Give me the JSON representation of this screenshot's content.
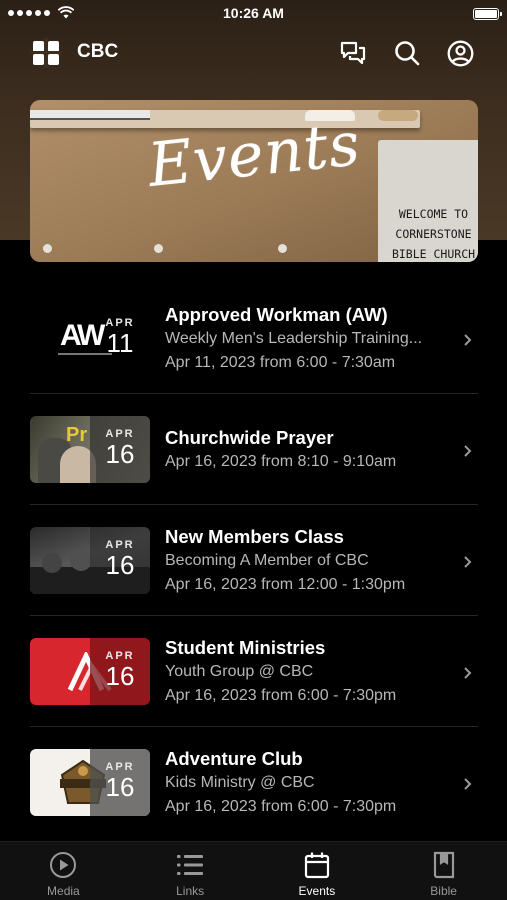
{
  "status_bar": {
    "time": "10:26 AM"
  },
  "header": {
    "app_title": "CBC",
    "icons": [
      "chat-icon",
      "search-icon",
      "profile-icon"
    ]
  },
  "hero": {
    "title": "Events",
    "sign_lines": [
      "WELCOME TO",
      "CORNERSTONE",
      "BIBLE CHURCH"
    ]
  },
  "events": [
    {
      "title": "Approved Workman (AW)",
      "subtitle": "Weekly Men's Leadership Training...",
      "schedule": "Apr 11, 2023 from 6:00 - 7:30am",
      "month": "APR",
      "day": "11",
      "thumb_text": "AW"
    },
    {
      "title": "Churchwide Prayer",
      "subtitle": "",
      "schedule": "Apr 16, 2023 from 8:10 - 9:10am",
      "month": "APR",
      "day": "16",
      "thumb_text": "Pr"
    },
    {
      "title": "New Members Class",
      "subtitle": "Becoming A Member of CBC",
      "schedule": "Apr 16, 2023 from 12:00 - 1:30pm",
      "month": "APR",
      "day": "16"
    },
    {
      "title": "Student Ministries",
      "subtitle": "Youth Group @ CBC",
      "schedule": "Apr 16, 2023 from 6:00 - 7:30pm",
      "month": "APR",
      "day": "16"
    },
    {
      "title": "Adventure Club",
      "subtitle": "Kids Ministry @ CBC",
      "schedule": "Apr 16, 2023 from 6:00 - 7:30pm",
      "month": "APR",
      "day": "16"
    }
  ],
  "tabs": [
    {
      "label": "Media",
      "icon": "play-icon",
      "active": false
    },
    {
      "label": "Links",
      "icon": "list-icon",
      "active": false
    },
    {
      "label": "Events",
      "icon": "calendar-icon",
      "active": true
    },
    {
      "label": "Bible",
      "icon": "book-icon",
      "active": false
    }
  ],
  "colors": {
    "background": "#000000",
    "header_brown": "#3d2e1f",
    "student_red": "#d8262f",
    "muted_text": "#b7b7b7"
  }
}
